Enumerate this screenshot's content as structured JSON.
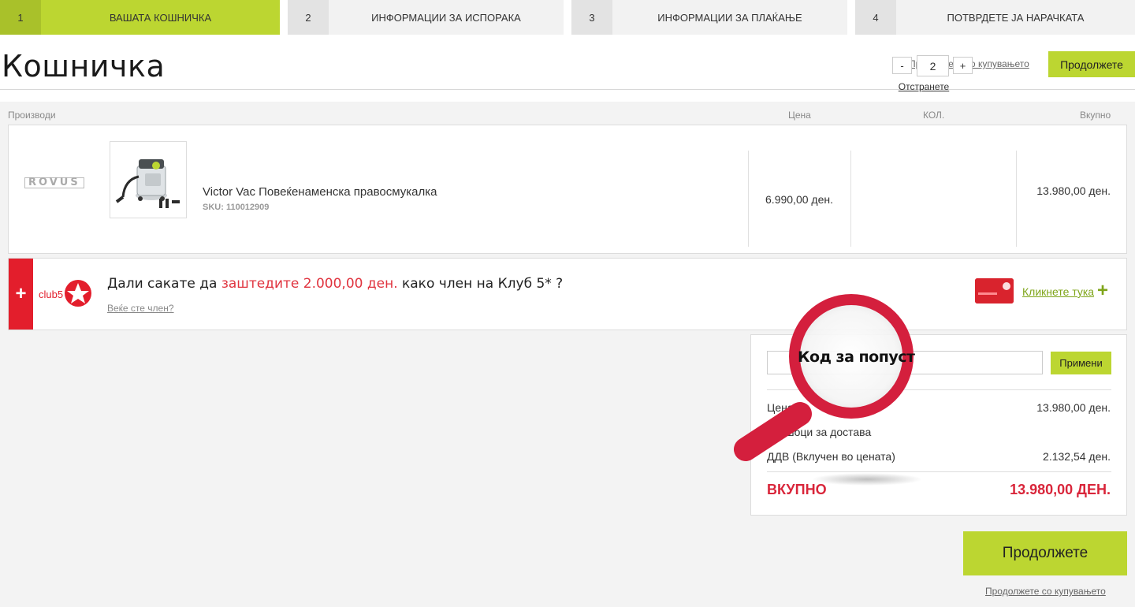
{
  "steps": [
    {
      "num": "1",
      "label": "ВАШАТА КОШНИЧКА",
      "active": true
    },
    {
      "num": "2",
      "label": "ИНФОРМАЦИИ ЗА ИСПОРАКА",
      "active": false
    },
    {
      "num": "3",
      "label": "ИНФОРМАЦИИ ЗА ПЛАЌАЊЕ",
      "active": false
    },
    {
      "num": "4",
      "label": "ПОТВРДЕТЕ ЈА НАРАЧКАТА",
      "active": false
    }
  ],
  "header": {
    "title": "Кошничка",
    "continue_shopping": "Продолжете со купувањето",
    "continue_button": "Продолжете"
  },
  "table": {
    "col_products": "Производи",
    "col_price": "Цена",
    "col_qty": "КОЛ.",
    "col_total": "Вкупно"
  },
  "product": {
    "brand": "ROVUS",
    "name": "Victor Vac Повеќенаменска правосмукалка",
    "sku": "SKU: 110012909",
    "price": "6.990,00 ден.",
    "qty_minus": "-",
    "qty": "2",
    "qty_plus": "+",
    "remove": "Отстранете",
    "total": "13.980,00 ден."
  },
  "club": {
    "plus": "+",
    "logo_text": "club5",
    "text_before": "Дали сакате да ",
    "text_highlight": "заштедите 2.000,00 ден.",
    "text_after": " како член на Клуб 5* ?",
    "already_member": "Веќе сте член?",
    "click_here": "Кликнете тука",
    "click_plus": "+"
  },
  "summary": {
    "coupon_placeholder": "",
    "apply": "Примени",
    "price_label": "Цена",
    "price_value": "13.980,00 ден.",
    "shipping_label": "Трошоци за достава",
    "vat_label": "ДДВ (Вклучен во цената)",
    "vat_value": "2.132,54 ден.",
    "total_label": "ВКУПНО",
    "total_value": "13.980,00 ДЕН."
  },
  "magnifier": {
    "label": "Код за попуст"
  },
  "footer": {
    "continue_button": "Продолжете",
    "continue_shopping": "Продолжете со купувањето"
  },
  "colors": {
    "accent_green": "#bcd631",
    "club_red": "#e31e2c",
    "total_red": "#d9253a",
    "link_green": "#7fa51a"
  }
}
